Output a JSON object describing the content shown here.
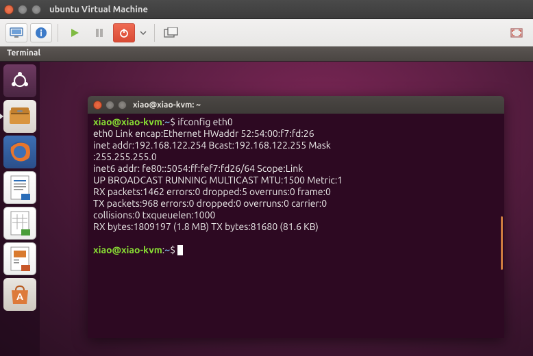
{
  "vm": {
    "title": "ubuntu Virtual Machine"
  },
  "tab": {
    "label": "Terminal"
  },
  "toolbar": {
    "icons": [
      "monitor",
      "info",
      "play",
      "pause",
      "power",
      "dropdown",
      "fullscreen",
      "fit"
    ]
  },
  "launcher": {
    "items": [
      {
        "name": "dash",
        "active": false
      },
      {
        "name": "files",
        "active": true
      },
      {
        "name": "firefox",
        "active": false
      },
      {
        "name": "writer",
        "active": false
      },
      {
        "name": "calc",
        "active": false
      },
      {
        "name": "impress",
        "active": false
      },
      {
        "name": "software",
        "active": false
      }
    ]
  },
  "terminal": {
    "title": "xiao@xiao-kvm: ~",
    "prompt_user": "xiao@xiao-kvm",
    "prompt_sep": ":",
    "prompt_path": "~",
    "prompt_end": "$",
    "command": "ifconfig eth0",
    "output": {
      "l1": "eth0      Link encap:Ethernet  HWaddr 52:54:00:f7:fd:26",
      "l2": "          inet addr:192.168.122.254  Bcast:192.168.122.255  Mask",
      "l2b": ":255.255.255.0",
      "l3": "          inet6 addr: fe80::5054:ff:fef7:fd26/64 Scope:Link",
      "l4": "          UP BROADCAST RUNNING MULTICAST  MTU:1500  Metric:1",
      "l5": "          RX packets:1462 errors:0 dropped:5 overruns:0 frame:0",
      "l6": "          TX packets:968 errors:0 dropped:0 overruns:0 carrier:0",
      "l7": "          collisions:0 txqueuelen:1000",
      "l8": "          RX bytes:1809197 (1.8 MB)  TX bytes:81680 (81.6 KB)"
    }
  }
}
